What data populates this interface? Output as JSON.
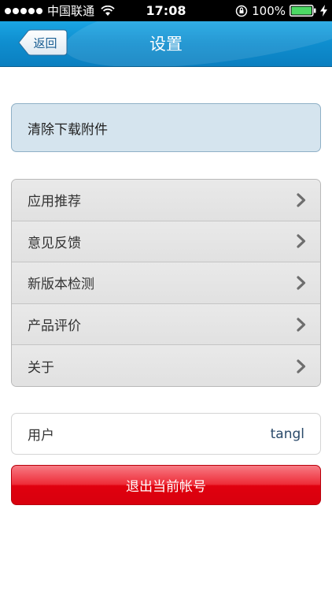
{
  "status_bar": {
    "carrier": "中国联通",
    "time": "17:08",
    "battery": "100%"
  },
  "nav": {
    "title": "设置",
    "back_label": "返回"
  },
  "clear_attachments_label": "清除下载附件",
  "menu": {
    "items": [
      {
        "label": "应用推荐",
        "icon": "chevron-right-icon"
      },
      {
        "label": "意见反馈",
        "icon": "chevron-right-icon"
      },
      {
        "label": "新版本检测",
        "icon": "chevron-right-icon"
      },
      {
        "label": "产品评价",
        "icon": "chevron-right-icon"
      },
      {
        "label": "关于",
        "icon": "chevron-right-icon"
      }
    ]
  },
  "user": {
    "label": "用户",
    "value": "tangl"
  },
  "logout_label": "退出当前帐号",
  "colors": {
    "nav_blue": "#0f8fd0",
    "logout_red": "#e0000f",
    "clear_bg": "#d5e4ee"
  }
}
